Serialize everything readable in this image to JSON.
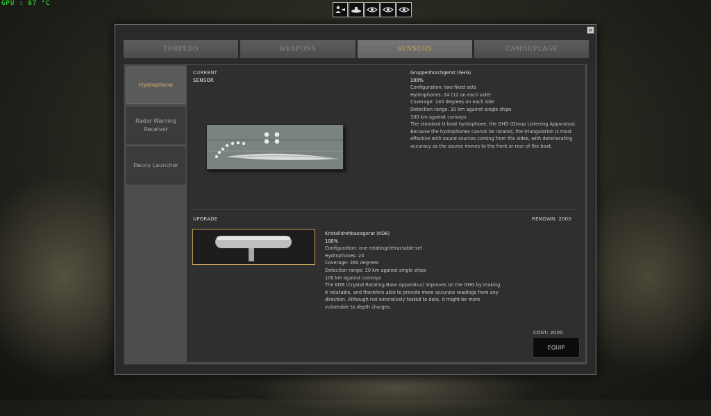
{
  "overlay": {
    "gpu_text": "GPU : 67 °C"
  },
  "topbar": {
    "icons": [
      "crew-icon",
      "submarine-icon",
      "eye-icon",
      "eye-icon",
      "eye-icon"
    ]
  },
  "tabs": [
    {
      "label": "TORPEDO",
      "active": false
    },
    {
      "label": "WEAPONS",
      "active": false
    },
    {
      "label": "SENSORS",
      "active": true
    },
    {
      "label": "CAMOUFLAGE",
      "active": false
    }
  ],
  "sidebar": {
    "items": [
      {
        "label": "Hydrophone",
        "active": true
      },
      {
        "label": "Radar Warning Receiver",
        "active": false
      },
      {
        "label": "Decoy Launcher",
        "active": false
      }
    ]
  },
  "current": {
    "label_line1": "CURRENT",
    "label_line2": "SENSOR",
    "name": "Gruppenhorchgerat (GHG)",
    "percent": "100%",
    "lines": [
      " Configuration: two fixed sets",
      " Hydrophones: 24 (12 on each side)",
      " Coverage: 140 degrees on each side",
      " Detection range: 20 km against single ships",
      " 100 km against convoys",
      " The standard U-boat hydrophone, the GHG (Group Listening Apparatus).",
      "Because the hydrophones cannot be rotated, the triangulation is most",
      "effective with sound sources coming from the sides, with deteriorating",
      "accuracy as the source moves to the front or rear of the boat."
    ]
  },
  "upgrade": {
    "label": "UPGRADE",
    "renown": "RENOWN: 2000",
    "name": "Kristalldrehbasisgerat (KDB)",
    "percent": "100%",
    "lines": [
      " Configuration: one rotating/retractable set",
      " Hydrophones: 24",
      " Coverage: 360 degrees",
      " Detection range: 20 km against single ships",
      " 100 km against convoys",
      " The KDB (Crystal Rotating Base Apparatus) improves on the GHG by making",
      "it rotatable, and therefore able to provide more accurate readings from any",
      "direction. Although not extensively tested to date, it might be more",
      "vulnerable to depth charges."
    ],
    "cost": "COST: 2000",
    "equip_label": "EQUIP"
  },
  "colors": {
    "accent": "#d2a455",
    "gpu_text": "#3cff3c"
  }
}
